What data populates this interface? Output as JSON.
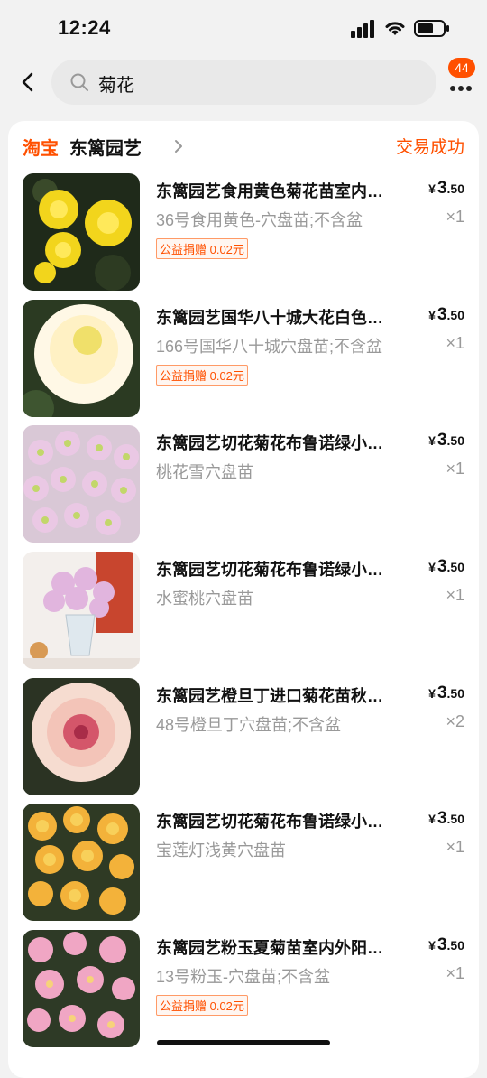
{
  "status_bar": {
    "time": "12:24"
  },
  "search": {
    "query": "菊花"
  },
  "more": {
    "badge": "44"
  },
  "order": {
    "brand": "淘宝",
    "shop_name": "东篱园艺",
    "status": "交易成功",
    "items": [
      {
        "title": "东篱园艺食用黄色菊花苗室内…",
        "price_currency": "¥",
        "price_int": "3",
        "price_dec": ".50",
        "sku": "36号食用黄色-穴盘苗;不含盆",
        "qty": "×1",
        "tag": "公益捐赠 0.02元",
        "image": "yellow-chrysanthemum"
      },
      {
        "title": "东篱园艺国华八十城大花白色…",
        "price_currency": "¥",
        "price_int": "3",
        "price_dec": ".50",
        "sku": "166号国华八十城穴盘苗;不含盆",
        "qty": "×1",
        "tag": "公益捐赠 0.02元",
        "image": "white-chrysanthemum"
      },
      {
        "title": "东篱园艺切花菊花布鲁诺绿小…",
        "price_currency": "¥",
        "price_int": "3",
        "price_dec": ".50",
        "sku": "桃花雪穴盘苗",
        "qty": "×1",
        "tag": "",
        "image": "pink-daisy-bouquet"
      },
      {
        "title": "东篱园艺切花菊花布鲁诺绿小…",
        "price_currency": "¥",
        "price_int": "3",
        "price_dec": ".50",
        "sku": "水蜜桃穴盘苗",
        "qty": "×1",
        "tag": "",
        "image": "pink-flowers-vase"
      },
      {
        "title": "东篱园艺橙旦丁进口菊花苗秋…",
        "price_currency": "¥",
        "price_int": "3",
        "price_dec": ".50",
        "sku": "48号橙旦丁穴盘苗;不含盆",
        "qty": "×2",
        "tag": "",
        "image": "peach-dahlia-chrysanthemum"
      },
      {
        "title": "东篱园艺切花菊花布鲁诺绿小…",
        "price_currency": "¥",
        "price_int": "3",
        "price_dec": ".50",
        "sku": "宝莲灯浅黄穴盘苗",
        "qty": "×1",
        "tag": "",
        "image": "yellow-orange-chrysanthemum"
      },
      {
        "title": "东篱园艺粉玉夏菊苗室内外阳…",
        "price_currency": "¥",
        "price_int": "3",
        "price_dec": ".50",
        "sku": "13号粉玉-穴盘苗;不含盆",
        "qty": "×1",
        "tag": "公益捐赠 0.02元",
        "image": "pink-chrysanthemum"
      }
    ]
  },
  "colors": {
    "accent": "#ff5000",
    "muted": "#999999",
    "background": "#f2f2f2"
  }
}
